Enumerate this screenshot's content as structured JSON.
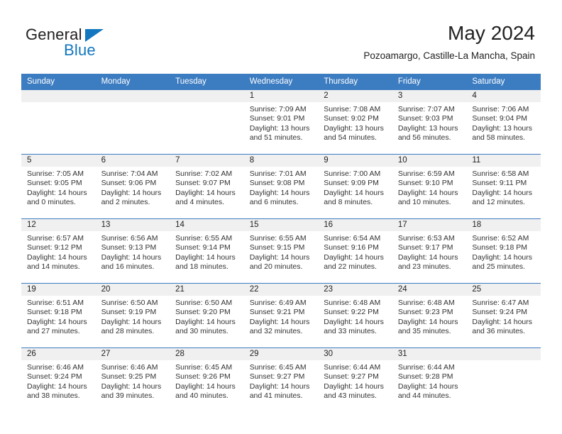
{
  "brand": {
    "word1": "General",
    "word2": "Blue",
    "triangle_color": "#1277bf",
    "text_color": "#231f20"
  },
  "header": {
    "title": "May 2024",
    "subtitle": "Pozoamargo, Castille-La Mancha, Spain"
  },
  "colors": {
    "header_blue": "#3c7cc1",
    "daynum_band": "#f0f0f0",
    "body_text": "#333333"
  },
  "weekdays": [
    "Sunday",
    "Monday",
    "Tuesday",
    "Wednesday",
    "Thursday",
    "Friday",
    "Saturday"
  ],
  "weeks": [
    [
      {
        "day": "",
        "sunrise": "",
        "sunset": "",
        "daylight1": "",
        "daylight2": ""
      },
      {
        "day": "",
        "sunrise": "",
        "sunset": "",
        "daylight1": "",
        "daylight2": ""
      },
      {
        "day": "",
        "sunrise": "",
        "sunset": "",
        "daylight1": "",
        "daylight2": ""
      },
      {
        "day": "1",
        "sunrise": "Sunrise: 7:09 AM",
        "sunset": "Sunset: 9:01 PM",
        "daylight1": "Daylight: 13 hours",
        "daylight2": "and 51 minutes."
      },
      {
        "day": "2",
        "sunrise": "Sunrise: 7:08 AM",
        "sunset": "Sunset: 9:02 PM",
        "daylight1": "Daylight: 13 hours",
        "daylight2": "and 54 minutes."
      },
      {
        "day": "3",
        "sunrise": "Sunrise: 7:07 AM",
        "sunset": "Sunset: 9:03 PM",
        "daylight1": "Daylight: 13 hours",
        "daylight2": "and 56 minutes."
      },
      {
        "day": "4",
        "sunrise": "Sunrise: 7:06 AM",
        "sunset": "Sunset: 9:04 PM",
        "daylight1": "Daylight: 13 hours",
        "daylight2": "and 58 minutes."
      }
    ],
    [
      {
        "day": "5",
        "sunrise": "Sunrise: 7:05 AM",
        "sunset": "Sunset: 9:05 PM",
        "daylight1": "Daylight: 14 hours",
        "daylight2": "and 0 minutes."
      },
      {
        "day": "6",
        "sunrise": "Sunrise: 7:04 AM",
        "sunset": "Sunset: 9:06 PM",
        "daylight1": "Daylight: 14 hours",
        "daylight2": "and 2 minutes."
      },
      {
        "day": "7",
        "sunrise": "Sunrise: 7:02 AM",
        "sunset": "Sunset: 9:07 PM",
        "daylight1": "Daylight: 14 hours",
        "daylight2": "and 4 minutes."
      },
      {
        "day": "8",
        "sunrise": "Sunrise: 7:01 AM",
        "sunset": "Sunset: 9:08 PM",
        "daylight1": "Daylight: 14 hours",
        "daylight2": "and 6 minutes."
      },
      {
        "day": "9",
        "sunrise": "Sunrise: 7:00 AM",
        "sunset": "Sunset: 9:09 PM",
        "daylight1": "Daylight: 14 hours",
        "daylight2": "and 8 minutes."
      },
      {
        "day": "10",
        "sunrise": "Sunrise: 6:59 AM",
        "sunset": "Sunset: 9:10 PM",
        "daylight1": "Daylight: 14 hours",
        "daylight2": "and 10 minutes."
      },
      {
        "day": "11",
        "sunrise": "Sunrise: 6:58 AM",
        "sunset": "Sunset: 9:11 PM",
        "daylight1": "Daylight: 14 hours",
        "daylight2": "and 12 minutes."
      }
    ],
    [
      {
        "day": "12",
        "sunrise": "Sunrise: 6:57 AM",
        "sunset": "Sunset: 9:12 PM",
        "daylight1": "Daylight: 14 hours",
        "daylight2": "and 14 minutes."
      },
      {
        "day": "13",
        "sunrise": "Sunrise: 6:56 AM",
        "sunset": "Sunset: 9:13 PM",
        "daylight1": "Daylight: 14 hours",
        "daylight2": "and 16 minutes."
      },
      {
        "day": "14",
        "sunrise": "Sunrise: 6:55 AM",
        "sunset": "Sunset: 9:14 PM",
        "daylight1": "Daylight: 14 hours",
        "daylight2": "and 18 minutes."
      },
      {
        "day": "15",
        "sunrise": "Sunrise: 6:55 AM",
        "sunset": "Sunset: 9:15 PM",
        "daylight1": "Daylight: 14 hours",
        "daylight2": "and 20 minutes."
      },
      {
        "day": "16",
        "sunrise": "Sunrise: 6:54 AM",
        "sunset": "Sunset: 9:16 PM",
        "daylight1": "Daylight: 14 hours",
        "daylight2": "and 22 minutes."
      },
      {
        "day": "17",
        "sunrise": "Sunrise: 6:53 AM",
        "sunset": "Sunset: 9:17 PM",
        "daylight1": "Daylight: 14 hours",
        "daylight2": "and 23 minutes."
      },
      {
        "day": "18",
        "sunrise": "Sunrise: 6:52 AM",
        "sunset": "Sunset: 9:18 PM",
        "daylight1": "Daylight: 14 hours",
        "daylight2": "and 25 minutes."
      }
    ],
    [
      {
        "day": "19",
        "sunrise": "Sunrise: 6:51 AM",
        "sunset": "Sunset: 9:18 PM",
        "daylight1": "Daylight: 14 hours",
        "daylight2": "and 27 minutes."
      },
      {
        "day": "20",
        "sunrise": "Sunrise: 6:50 AM",
        "sunset": "Sunset: 9:19 PM",
        "daylight1": "Daylight: 14 hours",
        "daylight2": "and 28 minutes."
      },
      {
        "day": "21",
        "sunrise": "Sunrise: 6:50 AM",
        "sunset": "Sunset: 9:20 PM",
        "daylight1": "Daylight: 14 hours",
        "daylight2": "and 30 minutes."
      },
      {
        "day": "22",
        "sunrise": "Sunrise: 6:49 AM",
        "sunset": "Sunset: 9:21 PM",
        "daylight1": "Daylight: 14 hours",
        "daylight2": "and 32 minutes."
      },
      {
        "day": "23",
        "sunrise": "Sunrise: 6:48 AM",
        "sunset": "Sunset: 9:22 PM",
        "daylight1": "Daylight: 14 hours",
        "daylight2": "and 33 minutes."
      },
      {
        "day": "24",
        "sunrise": "Sunrise: 6:48 AM",
        "sunset": "Sunset: 9:23 PM",
        "daylight1": "Daylight: 14 hours",
        "daylight2": "and 35 minutes."
      },
      {
        "day": "25",
        "sunrise": "Sunrise: 6:47 AM",
        "sunset": "Sunset: 9:24 PM",
        "daylight1": "Daylight: 14 hours",
        "daylight2": "and 36 minutes."
      }
    ],
    [
      {
        "day": "26",
        "sunrise": "Sunrise: 6:46 AM",
        "sunset": "Sunset: 9:24 PM",
        "daylight1": "Daylight: 14 hours",
        "daylight2": "and 38 minutes."
      },
      {
        "day": "27",
        "sunrise": "Sunrise: 6:46 AM",
        "sunset": "Sunset: 9:25 PM",
        "daylight1": "Daylight: 14 hours",
        "daylight2": "and 39 minutes."
      },
      {
        "day": "28",
        "sunrise": "Sunrise: 6:45 AM",
        "sunset": "Sunset: 9:26 PM",
        "daylight1": "Daylight: 14 hours",
        "daylight2": "and 40 minutes."
      },
      {
        "day": "29",
        "sunrise": "Sunrise: 6:45 AM",
        "sunset": "Sunset: 9:27 PM",
        "daylight1": "Daylight: 14 hours",
        "daylight2": "and 41 minutes."
      },
      {
        "day": "30",
        "sunrise": "Sunrise: 6:44 AM",
        "sunset": "Sunset: 9:27 PM",
        "daylight1": "Daylight: 14 hours",
        "daylight2": "and 43 minutes."
      },
      {
        "day": "31",
        "sunrise": "Sunrise: 6:44 AM",
        "sunset": "Sunset: 9:28 PM",
        "daylight1": "Daylight: 14 hours",
        "daylight2": "and 44 minutes."
      },
      {
        "day": "",
        "sunrise": "",
        "sunset": "",
        "daylight1": "",
        "daylight2": ""
      }
    ]
  ]
}
